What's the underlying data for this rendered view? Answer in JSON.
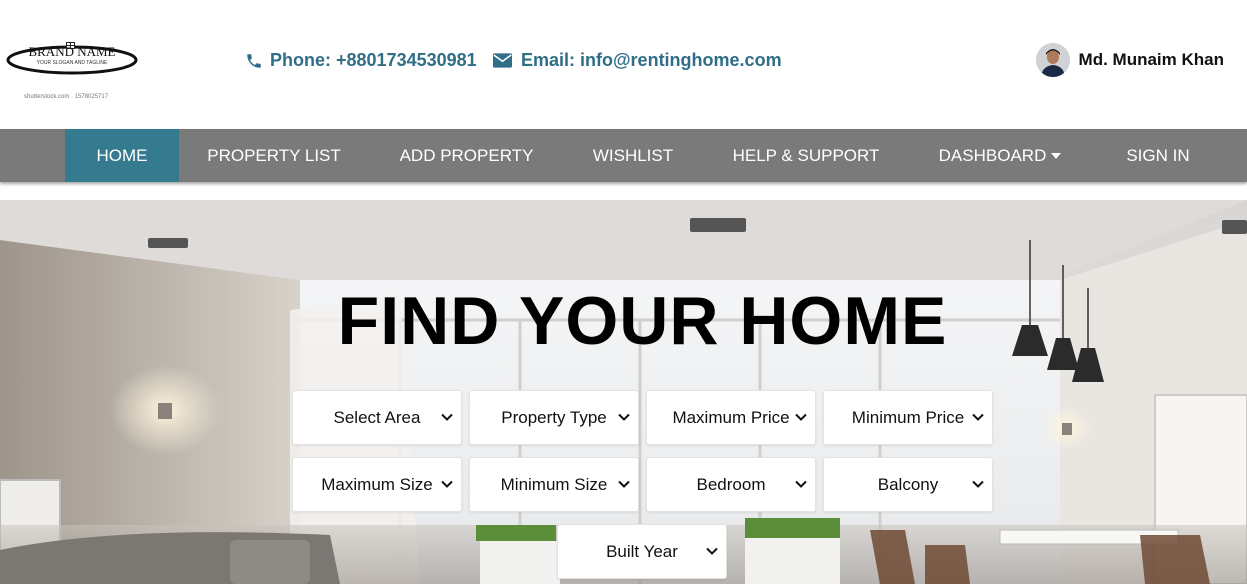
{
  "header": {
    "logo": {
      "text": "BRAND NAME",
      "tagline": "YOUR SLOGAN AND TAGLINE",
      "caption": "shutterstock.com · 1578025717"
    },
    "phone_label": "Phone: +8801734530981",
    "email_label": "Email: info@rentinghome.com",
    "user_name": "Md. Munaim Khan"
  },
  "nav": {
    "items": [
      {
        "label": "HOME",
        "active": true
      },
      {
        "label": "PROPERTY LIST"
      },
      {
        "label": "ADD PROPERTY"
      },
      {
        "label": "WISHLIST"
      },
      {
        "label": "HELP & SUPPORT"
      },
      {
        "label": "DASHBOARD",
        "has_dropdown": true
      },
      {
        "label": "SIGN IN"
      }
    ]
  },
  "hero": {
    "title": "FIND YOUR HOME",
    "filters": [
      "Select Area",
      "Property Type",
      "Maximum Price",
      "Minimum Price",
      "Maximum Size",
      "Minimum Size",
      "Bedroom",
      "Balcony",
      "Built Year"
    ]
  },
  "colors": {
    "accent": "#2f6e86",
    "nav_bg": "#7a7a7a",
    "nav_active": "#357a8e"
  },
  "icons": {
    "phone": "phone-icon",
    "email": "envelope-icon",
    "dropdown": "caret-down-icon",
    "select": "chevron-down-icon"
  }
}
